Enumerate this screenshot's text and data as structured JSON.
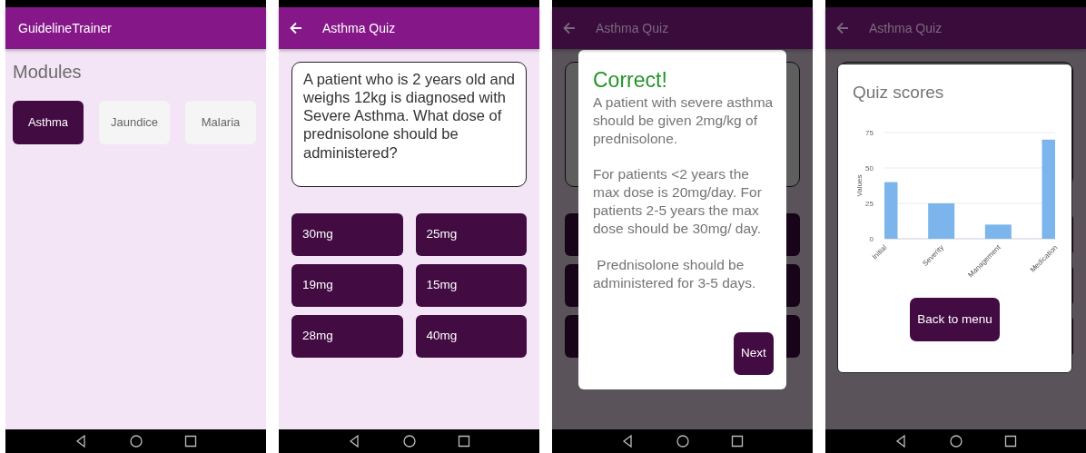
{
  "screens": [
    {
      "kind": "modules",
      "dimmed": false,
      "app_bar": {
        "title": "GuidelineTrainer",
        "back": false
      },
      "heading": "Modules",
      "modules": [
        {
          "label": "Asthma",
          "selected": true
        },
        {
          "label": "Jaundice",
          "selected": false
        },
        {
          "label": "Malaria",
          "selected": false
        }
      ]
    },
    {
      "kind": "quiz",
      "dimmed": false,
      "app_bar": {
        "title": "Asthma Quiz",
        "back": true
      },
      "question": "A patient who is 2 years old and weighs 12kg is diagnosed with Severe Asthma. What dose of prednisolone should be administered?",
      "answers": [
        "30mg",
        "25mg",
        "19mg",
        "15mg",
        "28mg",
        "40mg"
      ]
    },
    {
      "kind": "feedback",
      "dimmed": true,
      "app_bar": {
        "title": "Asthma Quiz",
        "back": true
      },
      "dialog": {
        "title": "Correct!",
        "paragraphs": [
          "A patient with severe asthma should be given 2mg/kg of prednisolone.",
          "For patients <2 years the max dose is 20mg/day. For patients 2-5 years the max dose should be 30mg/ day.",
          " Prednisolone should be administered for 3-5 days."
        ],
        "button": "Next"
      }
    },
    {
      "kind": "scores",
      "dimmed": true,
      "app_bar": {
        "title": "Asthma Quiz",
        "back": true
      },
      "card": {
        "title": "Quiz scores",
        "chart_data": {
          "type": "bar",
          "ylabel": "Values",
          "categories": [
            "Initial",
            "Severity",
            "Management",
            "Medication"
          ],
          "series": [
            {
              "color": "#7cb5ec",
              "values": [
                40,
                25,
                10,
                70
              ]
            }
          ],
          "ylim": [
            0,
            75
          ],
          "yticks": [
            0,
            25,
            50,
            75
          ]
        },
        "button": "Back to menu"
      }
    }
  ]
}
